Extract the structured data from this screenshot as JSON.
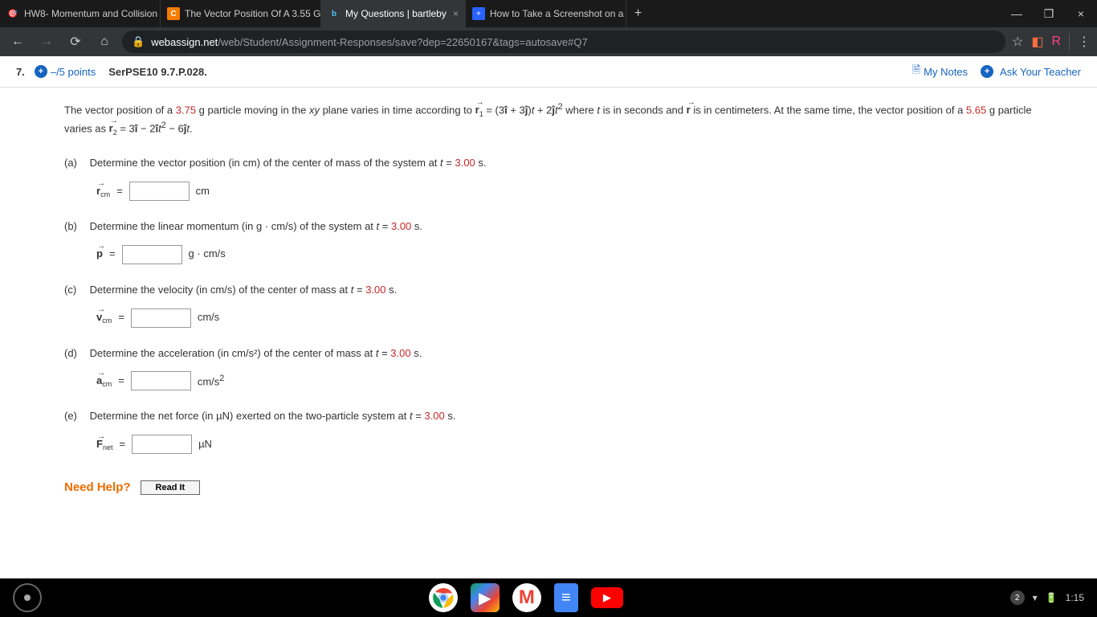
{
  "tabs": [
    {
      "title": "HW8- Momentum and Collision",
      "active": false,
      "icon": "🎯"
    },
    {
      "title": "The Vector Position Of A 3.55 G",
      "active": false,
      "icon": "C"
    },
    {
      "title": "My Questions | bartleby",
      "active": true,
      "icon": "b"
    },
    {
      "title": "How to Take a Screenshot on a C",
      "active": false,
      "icon": "+"
    }
  ],
  "url": {
    "domain": "webassign.net",
    "path": "/web/Student/Assignment-Responses/save?dep=22650167&tags=autosave#Q7"
  },
  "question": {
    "number": "7.",
    "points": "–/5 points",
    "id": "SerPSE10 9.7.P.028.",
    "my_notes": "My Notes",
    "ask_teacher": "Ask Your Teacher"
  },
  "problem": {
    "mass1": "3.75",
    "mass2": "5.65",
    "time_val": "3.00",
    "intro_a": "The vector position of a ",
    "intro_b": " g particle moving in the ",
    "intro_c": " plane varies in time according to ",
    "intro_d": " where ",
    "intro_e": " is in seconds and ",
    "intro_f": " is in centimeters. At the same time, the vector position of a ",
    "intro_g": " g particle varies as "
  },
  "parts": {
    "a": {
      "label": "(a)",
      "text": "Determine the vector position (in cm) of the center of mass of the system at ",
      "var": "r",
      "sub": "cm",
      "unit": "cm"
    },
    "b": {
      "label": "(b)",
      "text": "Determine the linear momentum (in g · cm/s) of the system at ",
      "var": "p",
      "sub": "",
      "unit": "g · cm/s"
    },
    "c": {
      "label": "(c)",
      "text": "Determine the velocity (in cm/s) of the center of mass at ",
      "var": "v",
      "sub": "cm",
      "unit": "cm/s"
    },
    "d": {
      "label": "(d)",
      "text": "Determine the acceleration (in cm/s²) of the center of mass at ",
      "var": "a",
      "sub": "cm",
      "unit": "cm/s²"
    },
    "e": {
      "label": "(e)",
      "text": "Determine the net force (in µN) exerted on the two-particle system at ",
      "var": "F",
      "sub": "net",
      "unit": "µN"
    }
  },
  "help": {
    "label": "Need Help?",
    "read_it": "Read It"
  },
  "dock": {
    "time": "1:15",
    "notif": "2"
  }
}
